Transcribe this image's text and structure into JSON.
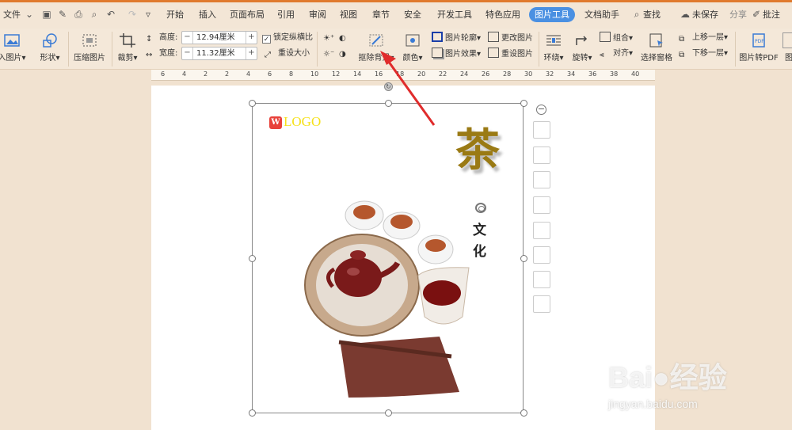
{
  "menu": {
    "file": "文件",
    "tabs": [
      "开始",
      "插入",
      "页面布局",
      "引用",
      "审阅",
      "视图",
      "章节",
      "安全",
      "开发工具",
      "特色应用"
    ],
    "active_tab": "图片工具",
    "doc_helper": "文档助手",
    "search": "查找",
    "unsaved": "未保存",
    "share": "分享",
    "comment": "批注"
  },
  "ribbon": {
    "insert_picture": "入图片",
    "shape": "形状",
    "compress": "压缩图片",
    "crop": "裁剪",
    "height_label": "高度:",
    "height_value": "12.94厘米",
    "width_label": "宽度:",
    "width_value": "11.32厘米",
    "lock_ratio": "锁定纵横比",
    "reset_size": "重设大小",
    "remove_bg": "抠除背景",
    "color": "颜色",
    "outline": "图片轮廓",
    "effects": "图片效果",
    "change_pic": "更改图片",
    "reset_pic": "重设图片",
    "wrap": "环绕",
    "rotate": "旋转",
    "group": "组合",
    "align": "对齐",
    "selection_pane": "选择窗格",
    "bring_forward": "上移一层",
    "send_backward": "下移一层",
    "to_pdf": "图片转PDF",
    "more": "图"
  },
  "ruler": {
    "ticks": [
      "6",
      "4",
      "2",
      "2",
      "4",
      "6",
      "8",
      "10",
      "12",
      "14",
      "16",
      "18",
      "20",
      "22",
      "24",
      "26",
      "28",
      "30",
      "32",
      "34",
      "36",
      "38",
      "40"
    ]
  },
  "document": {
    "logo_mark": "W",
    "logo_text": "LOGO",
    "title_char": "茶",
    "subtitle": "文化"
  },
  "watermark": {
    "brand": "Bai●经验",
    "url": "jingyan.baidu.com"
  },
  "colors": {
    "active_tab": "#4a90e2",
    "accent_bar": "#e07a2e",
    "logo_yellow": "#f6e11a",
    "tea_char": "#9a7a14",
    "arrow_red": "#e02c2c"
  }
}
